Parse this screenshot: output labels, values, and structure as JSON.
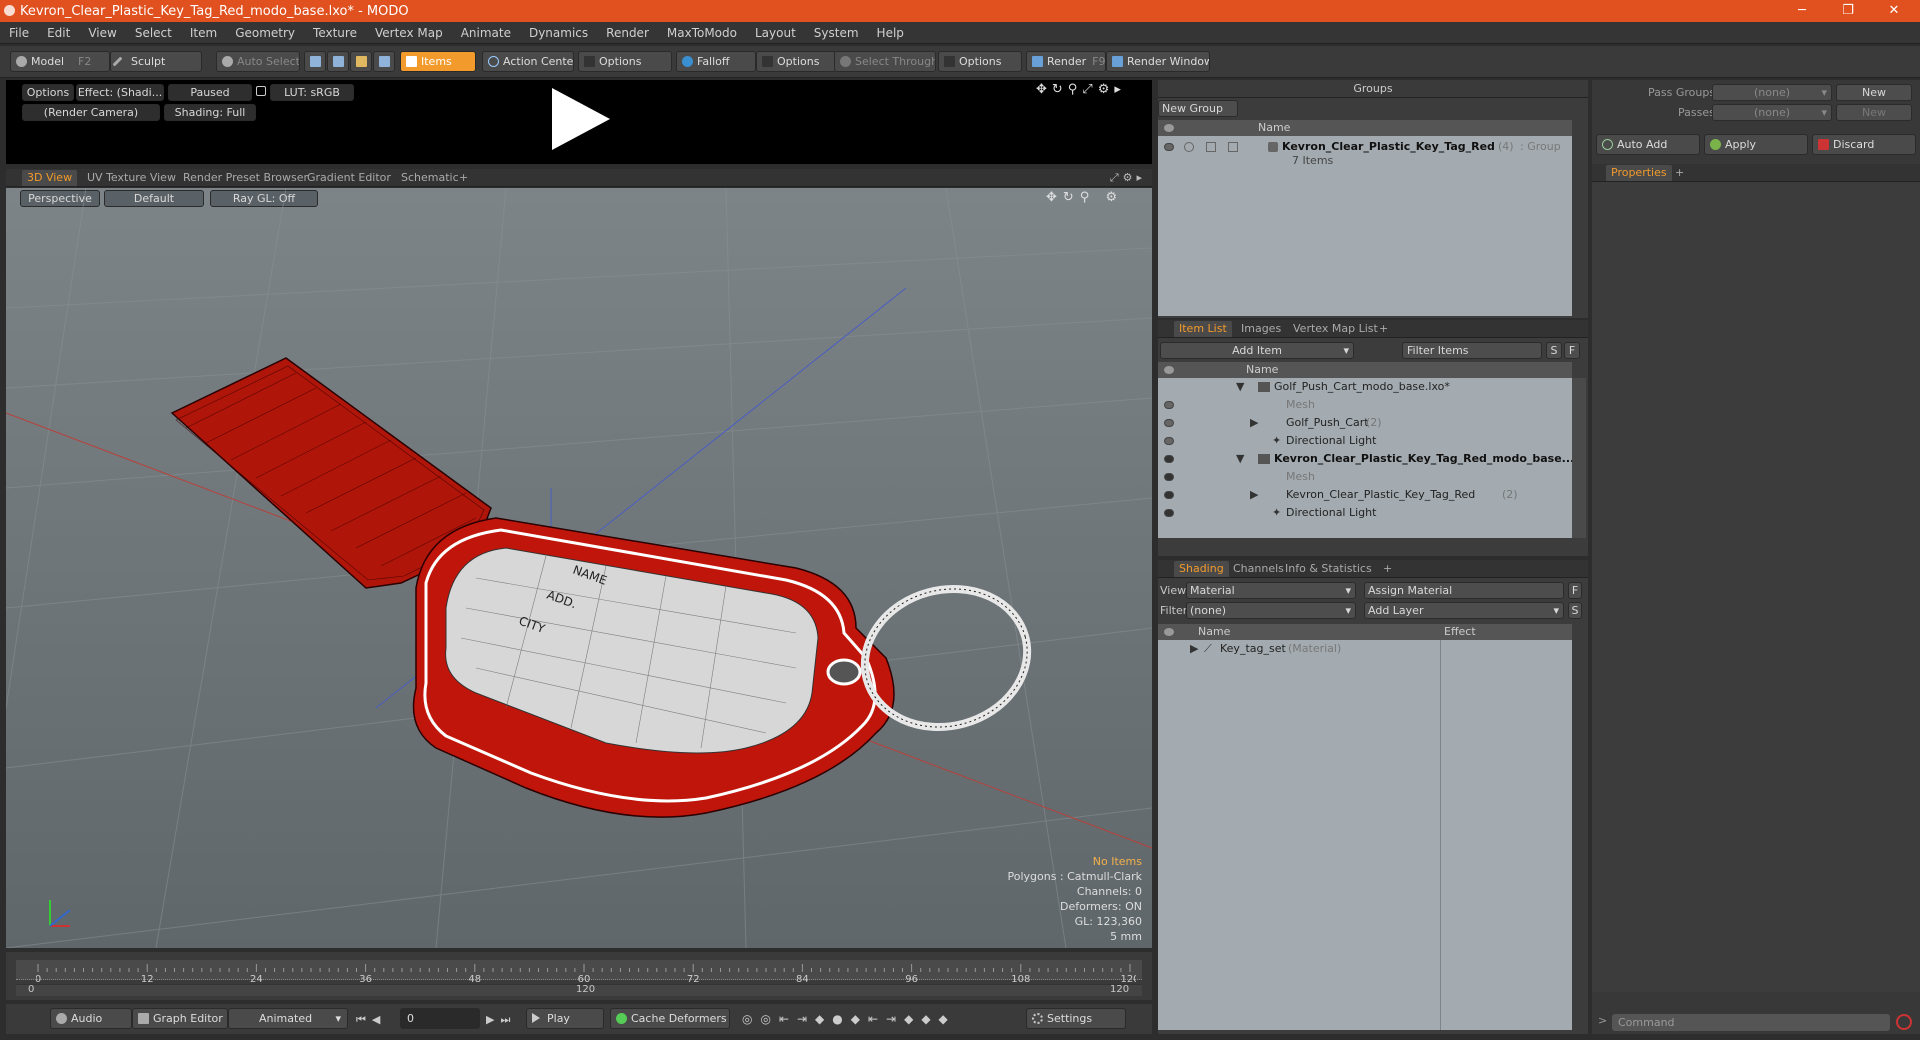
{
  "window": {
    "title": "Kevron_Clear_Plastic_Key_Tag_Red_modo_base.lxo* - MODO",
    "min": "─",
    "max": "❐",
    "close": "✕"
  },
  "menu": [
    "File",
    "Edit",
    "View",
    "Select",
    "Item",
    "Geometry",
    "Texture",
    "Vertex Map",
    "Animate",
    "Dynamics",
    "Render",
    "MaxToModo",
    "Layout",
    "System",
    "Help"
  ],
  "toolbar": {
    "model": "Model",
    "model_key": "F2",
    "sculpt": "Sculpt",
    "auto_select": "Auto Select",
    "items": "Items",
    "action_center": "Action Center",
    "options1": "Options",
    "falloff": "Falloff",
    "options2": "Options",
    "select_through": "Select Through",
    "options3": "Options",
    "render": "Render",
    "render_key": "F9",
    "render_window": "Render Window"
  },
  "preview": {
    "options": "Options",
    "effect": "Effect: (Shadi...",
    "paused": "Paused",
    "lut": "LUT: sRGB",
    "camera": "(Render Camera)",
    "shading": "Shading: Full"
  },
  "viewport_tabs": [
    "3D View",
    "UV Texture View",
    "Render Preset Browser",
    "Gradient Editor",
    "Schematic",
    "+"
  ],
  "viewport": {
    "perspective": "Perspective",
    "default": "Default",
    "raygl": "Ray GL: Off",
    "tag_labels": [
      "NAME",
      "ADD.",
      "CITY"
    ],
    "hud": {
      "no_items": "No Items",
      "polygons": "Polygons : Catmull-Clark",
      "channels": "Channels: 0",
      "deformers": "Deformers: ON",
      "gl": "GL: 123,360",
      "unit": "5 mm"
    }
  },
  "timeline": {
    "ticks": [
      "0",
      "12",
      "24",
      "36",
      "48",
      "60",
      "72",
      "84",
      "96",
      "108",
      "120"
    ],
    "low": [
      "0",
      "120",
      "120"
    ]
  },
  "bottombar": {
    "audio": "Audio",
    "graph_editor": "Graph Editor",
    "animated": "Animated",
    "frame": "0",
    "play": "Play",
    "cache": "Cache Deformers",
    "settings": "Settings"
  },
  "groups": {
    "title": "Groups",
    "new_group": "New Group",
    "col_name": "Name",
    "row_name": "Kevron_Clear_Plastic_Key_Tag_Red",
    "row_count": "(4)",
    "row_type": ": Group",
    "row_items": "7 Items"
  },
  "right": {
    "pass_groups": "Pass Groups",
    "passes": "Passes",
    "none": "(none)",
    "new": "New",
    "auto_add": "Auto Add",
    "apply": "Apply",
    "discard": "Discard",
    "properties": "Properties"
  },
  "itemlist": {
    "tabs": [
      "Item List",
      "Images",
      "Vertex Map List",
      "+"
    ],
    "add_item": "Add Item",
    "filter": "Filter Items",
    "s": "S",
    "f": "F",
    "col_name": "Name",
    "rows": [
      {
        "label": "Golf_Push_Cart_modo_base.lxo*",
        "suffix": ""
      },
      {
        "label": "Mesh",
        "suffix": ""
      },
      {
        "label": "Golf_Push_Cart",
        "suffix": "(2)"
      },
      {
        "label": "Directional Light",
        "suffix": ""
      },
      {
        "label": "Kevron_Clear_Plastic_Key_Tag_Red_modo_base....",
        "suffix": ""
      },
      {
        "label": "Mesh",
        "suffix": ""
      },
      {
        "label": "Kevron_Clear_Plastic_Key_Tag_Red",
        "suffix": "(2)"
      },
      {
        "label": "Directional Light",
        "suffix": ""
      }
    ]
  },
  "shading": {
    "tabs": [
      "Shading",
      "Channels",
      "Info & Statistics",
      "+"
    ],
    "view_label": "View",
    "view_value": "Material",
    "assign": "Assign Material",
    "f": "F",
    "filter_label": "Filter",
    "filter_value": "(none)",
    "add_layer": "Add Layer",
    "s": "S",
    "col_name": "Name",
    "col_effect": "Effect",
    "row": "Key_tag_set",
    "row_type": "(Material)"
  },
  "command": {
    "placeholder": "Command"
  },
  "colors": {
    "accent": "#f29a2b",
    "title": "#e0511f",
    "tag_red": "#c0150a"
  }
}
